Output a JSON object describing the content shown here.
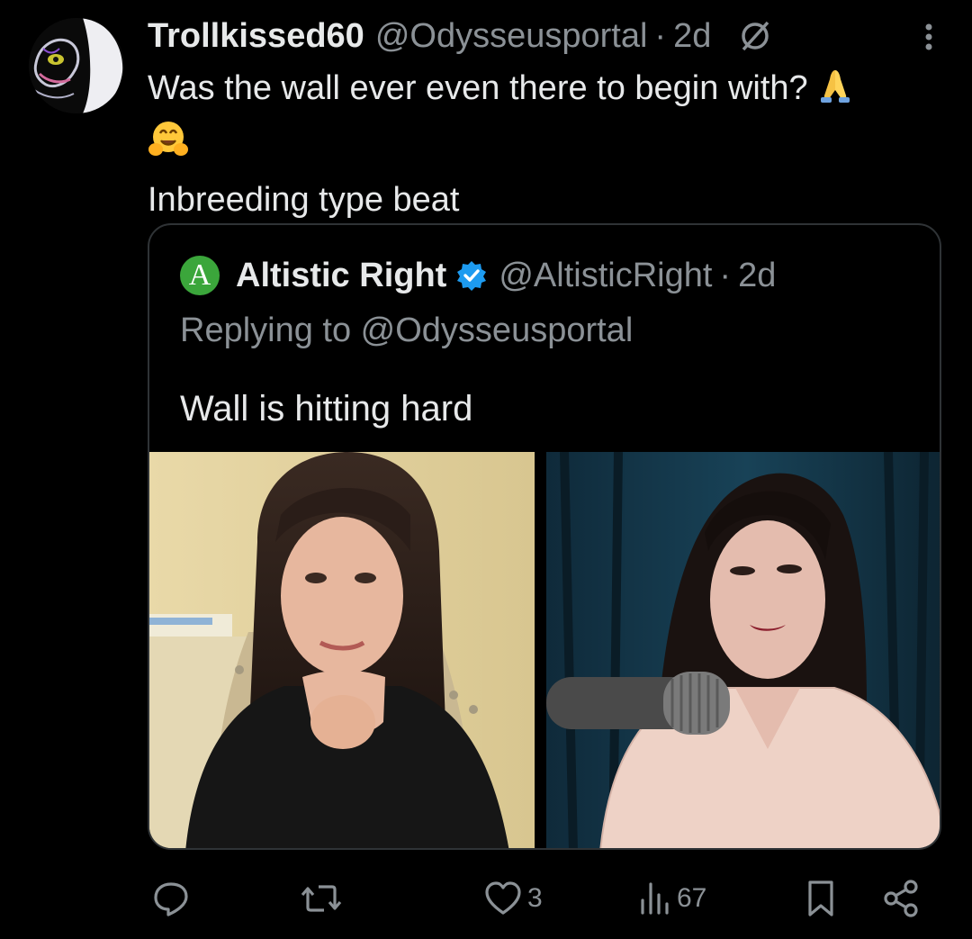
{
  "tweet": {
    "display_name": "Trollkissed60",
    "handle": "@Odysseusportal",
    "separator": "·",
    "time": "2d",
    "text_line1": "Was the wall ever even there to begin with?",
    "emoji_pray": "🙏",
    "emoji_hug": "🤗",
    "text_line3": "Inbreeding type beat",
    "icons": {
      "grok": "grok-icon",
      "more": "more-icon"
    }
  },
  "quote": {
    "avatar_letter": "A",
    "display_name": "Altistic Right",
    "handle": "@AltisticRight",
    "separator": "·",
    "time": "2d",
    "replying_to": "Replying to @Odysseusportal",
    "text": "Wall is hitting hard",
    "colors": {
      "avatar_bg": "#3ba63b",
      "verified": "#1d9bf0"
    }
  },
  "actions": {
    "reply_count": "",
    "retweet_count": "",
    "like_count": "3",
    "views_count": "67"
  },
  "colors": {
    "background": "#000000",
    "text": "#e7e9ea",
    "muted": "#8b9196",
    "border": "#2f3336"
  }
}
